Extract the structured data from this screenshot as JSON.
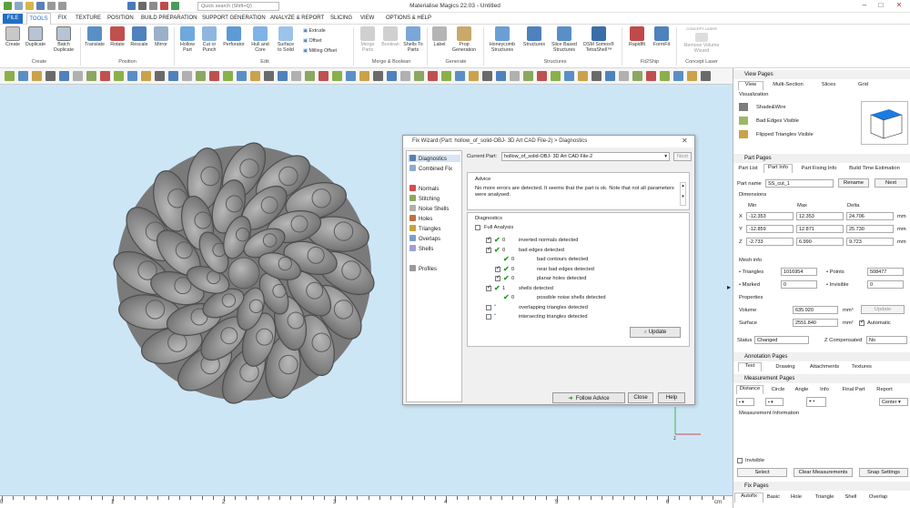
{
  "titlebar": {
    "title": "Materialise Magics 22.03 - Untitled",
    "search_placeholder": "Quick search (Shift+Q)"
  },
  "menu": [
    "FILE",
    "TOOLS",
    "FIX",
    "TEXTURE",
    "POSITION",
    "BUILD PREPARATION",
    "SUPPORT GENERATION",
    "ANALYZE & REPORT",
    "SLICING",
    "VIEW",
    "OPTIONS & HELP"
  ],
  "ribbon": {
    "buttons": [
      {
        "label": "Create",
        "name": "create-button"
      },
      {
        "label": "Duplicate",
        "name": "duplicate-button"
      },
      {
        "label": "Batch Duplicate",
        "name": "batch-duplicate-button"
      },
      {
        "label": "Translate",
        "name": "translate-button"
      },
      {
        "label": "Rotate",
        "name": "rotate-button"
      },
      {
        "label": "Rescale",
        "name": "rescale-button"
      },
      {
        "label": "Mirror",
        "name": "mirror-button"
      },
      {
        "label": "Hollow Part",
        "name": "hollow-part-button"
      },
      {
        "label": "Cut or Punch",
        "name": "cut-or-punch-button"
      },
      {
        "label": "Perforator",
        "name": "perforator-button"
      },
      {
        "label": "Hull and Core",
        "name": "hull-and-core-button"
      },
      {
        "label": "Surface to Solid",
        "name": "surface-to-solid-button"
      },
      {
        "label": "Merge Parts",
        "name": "merge-parts-button"
      },
      {
        "label": "Boolean",
        "name": "boolean-button"
      },
      {
        "label": "Shells To Parts",
        "name": "shells-to-parts-button"
      },
      {
        "label": "Label",
        "name": "label-button"
      },
      {
        "label": "Prop Generation",
        "name": "prop-generation-button"
      },
      {
        "label": "Honeycomb Structures",
        "name": "honeycomb-structures-button"
      },
      {
        "label": "Structures",
        "name": "structures-button"
      },
      {
        "label": "Slice Based Structures",
        "name": "slice-based-structures-button"
      },
      {
        "label": "DSM Somos® TetraShell™",
        "name": "tetrashell-button"
      },
      {
        "label": "Rapidfit",
        "name": "rapidfit-button"
      },
      {
        "label": "FormFit",
        "name": "formfit-button"
      },
      {
        "label": "Remove Volume Wizard",
        "name": "remove-volume-wizard-button"
      }
    ],
    "small_buttons": [
      "Extrude",
      "Offset",
      "Milling Offset"
    ],
    "concept_laser_logo": "CONCEPT LASER",
    "groups": [
      "Create",
      "Position",
      "Edit",
      "Merge & Boolean",
      "Generate",
      "Structures",
      "Fit2Ship",
      "Concept Laser"
    ]
  },
  "ruler": {
    "labels": [
      "0",
      "1",
      "2",
      "3",
      "4",
      "5",
      "6"
    ],
    "unit": "cm"
  },
  "axes": {
    "z": "z",
    "x": "x"
  },
  "panel": {
    "view_pages": {
      "header": "View Pages",
      "tabs": [
        "View",
        "Multi-Section",
        "Slices",
        "Grid"
      ],
      "visualization": "Visualization",
      "items": [
        "Shade&Wire",
        "Bad Edges Visible",
        "Flipped Triangles Visible"
      ]
    },
    "part_pages": {
      "header": "Part Pages",
      "tabs": [
        "Part List",
        "Part Info",
        "Part Fixing Info",
        "Build Time Estimation"
      ],
      "part_name_label": "Part name",
      "part_name": "SS_cut_1",
      "rename": "Rename",
      "next": "Next",
      "dimensions": "Dimensions",
      "cols": [
        "Min",
        "Max",
        "Delta"
      ],
      "rows": [
        {
          "axis": "X",
          "min": "-12.353",
          "max": "12.353",
          "delta": "24.706",
          "unit": "mm"
        },
        {
          "axis": "Y",
          "min": "-12.859",
          "max": "12.871",
          "delta": "25.730",
          "unit": "mm"
        },
        {
          "axis": "Z",
          "min": "-2.733",
          "max": "6.990",
          "delta": "9.723",
          "unit": "mm"
        }
      ],
      "mesh_info": "Mesh info",
      "triangles_label": "Triangles",
      "triangles": "1016954",
      "points_label": "Points",
      "points": "508477",
      "marked_label": "Marked",
      "marked": "0",
      "invisible_label": "Invisible",
      "invisible": "0",
      "properties": "Properties",
      "volume_label": "Volume",
      "volume": "635.920",
      "volume_unit": "mm³",
      "update": "Update",
      "surface_label": "Surface",
      "surface": "2551.840",
      "surface_unit": "mm²",
      "automatic": "Automatic",
      "status_label": "Status",
      "status": "Changed",
      "zcomp_label": "Z Compensated",
      "zcomp": "No"
    },
    "annotation_pages": {
      "header": "Annotation Pages",
      "tabs": [
        "Text",
        "Drawing",
        "Attachments",
        "Textures"
      ]
    },
    "measurement_pages": {
      "header": "Measurement Pages",
      "tabs": [
        "Distance",
        "Circle",
        "Angle",
        "Info",
        "Final Part",
        "Report"
      ],
      "center": "Center",
      "info_label": "Measurement Information",
      "invisible": "Invisible",
      "select": "Select",
      "clear": "Clear Measurements",
      "snap": "Snap Settings"
    },
    "fix_pages": {
      "header": "Fix Pages",
      "tabs": [
        "Autofix",
        "Basic",
        "Hole",
        "Triangle",
        "Shell",
        "Overlap"
      ]
    }
  },
  "dialog": {
    "title": "Fix Wizard (Part: hollow_of_solid-OBJ- 3D Art CAD File-2) > Diagnostics",
    "nav": [
      "Diagnostics",
      "Combined Fix",
      "Normals",
      "Stitching",
      "Noise Shells",
      "Holes",
      "Triangles",
      "Overlaps",
      "Shells",
      "Profiles"
    ],
    "current_part_label": "Current Part:",
    "current_part": "hollow_of_solid-OBJ- 3D Art CAD File-2",
    "next": "Next",
    "advice_label": "Advice",
    "advice_text": "No more errors are detected. It seems that the part is ok. Note that not all parameters were analysed.",
    "diagnostics_label": "Diagnostics",
    "full_analysis": "Full Analysis",
    "rows": [
      {
        "count": "0",
        "text": "inverted normals detected",
        "indent": 0,
        "check": true,
        "box": true
      },
      {
        "count": "0",
        "text": "bad edges detected",
        "indent": 0,
        "check": true,
        "box": true
      },
      {
        "count": "0",
        "text": "bad contours detected",
        "indent": 1,
        "check": true,
        "box": false
      },
      {
        "count": "0",
        "text": "near bad edges detected",
        "indent": 1,
        "check": true,
        "box": true
      },
      {
        "count": "0",
        "text": "planar holes detected",
        "indent": 1,
        "check": true,
        "box": true
      },
      {
        "count": "1",
        "text": "shells detected",
        "indent": 0,
        "check": true,
        "box": true
      },
      {
        "count": "0",
        "text": "possible noise shells detected",
        "indent": 1,
        "check": true,
        "box": false
      },
      {
        "count": "",
        "text": "overlapping triangles detected",
        "indent": 0,
        "check": false,
        "box": true
      },
      {
        "count": "",
        "text": "intersecting triangles detected",
        "indent": 0,
        "check": false,
        "box": true
      }
    ],
    "update": "Update",
    "follow_advice": "Follow Advice",
    "close": "Close",
    "help": "Help"
  }
}
